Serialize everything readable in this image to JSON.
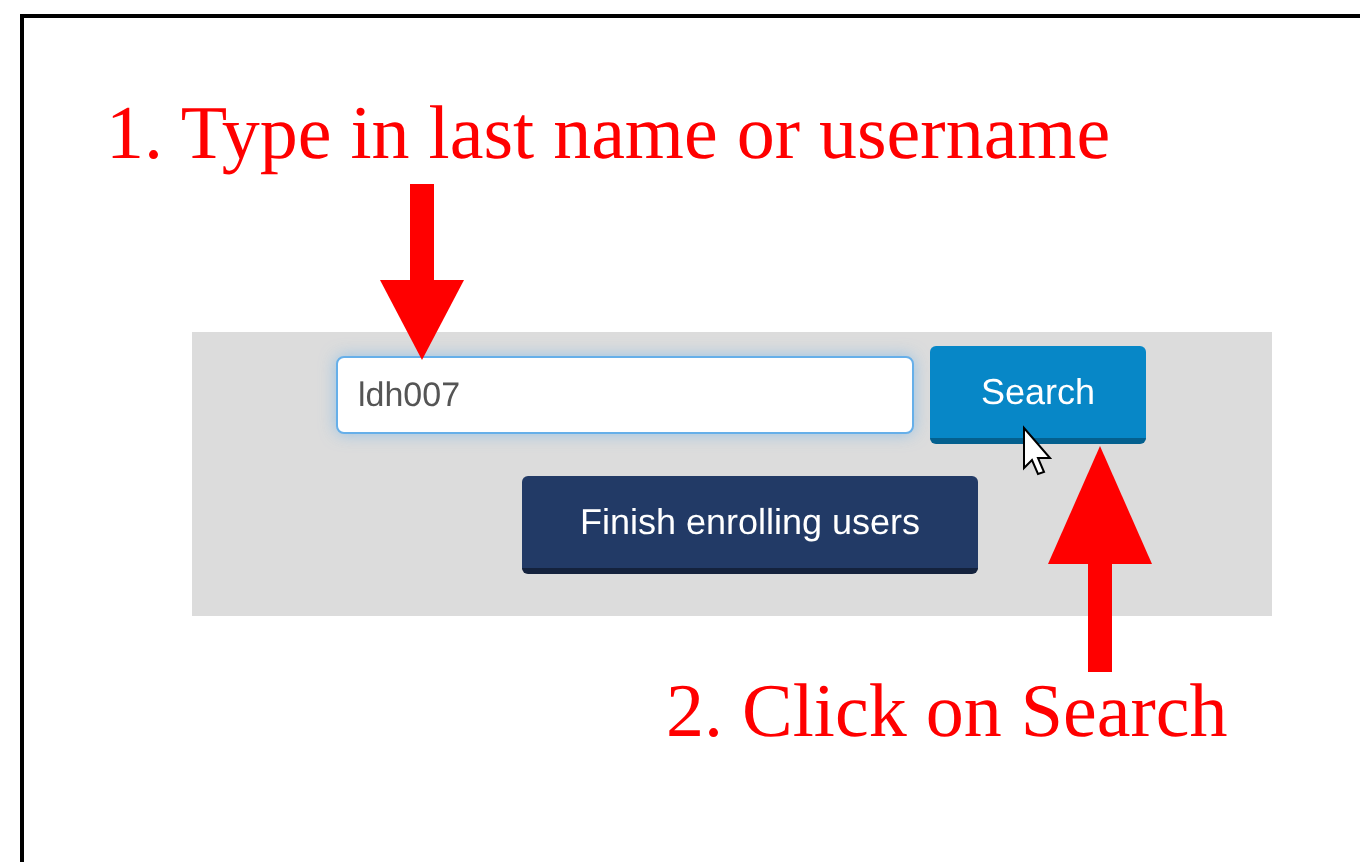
{
  "annotations": [
    {
      "text": "1. Type in last name or username"
    },
    {
      "text": "2. Click on Search"
    }
  ],
  "search": {
    "value": "ldh007",
    "focused": true
  },
  "buttons": [
    {
      "label": "Search",
      "kind": "primary"
    },
    {
      "label": "Finish enrolling users",
      "kind": "dark"
    }
  ]
}
